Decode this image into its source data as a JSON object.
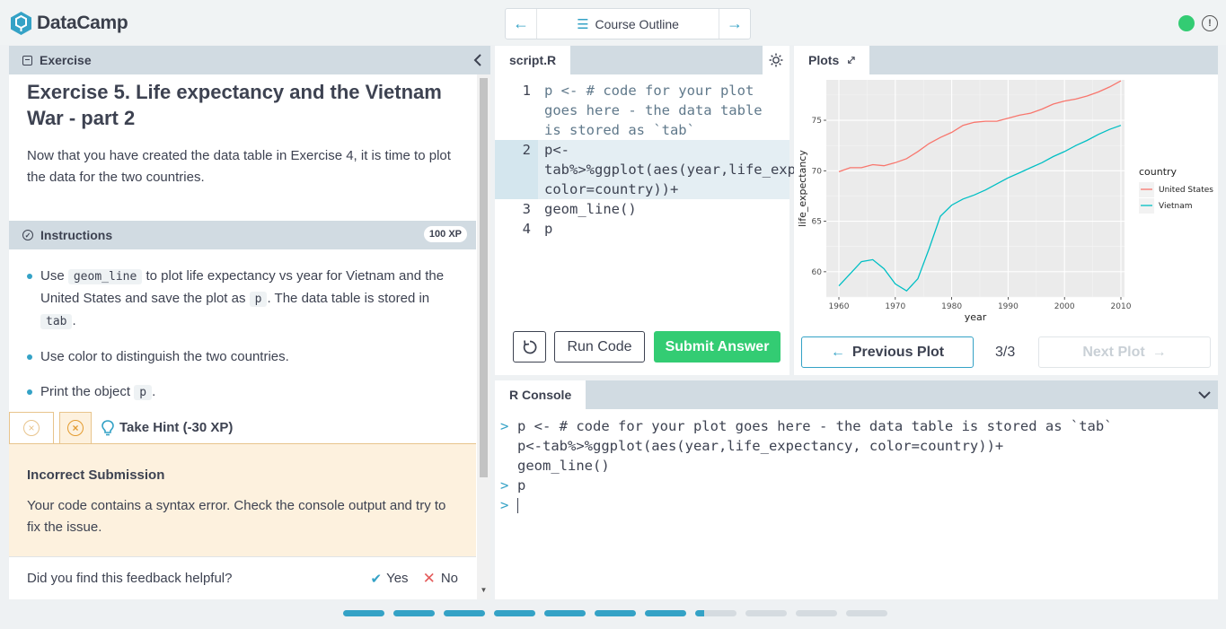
{
  "header": {
    "brand": "DataCamp",
    "nav_label": "Course Outline",
    "status_color": "#33CC73"
  },
  "exercise": {
    "panel_title": "Exercise",
    "title": "Exercise 5. Life expectancy and the Vietnam War - part 2",
    "description": "Now that you have created the data table in Exercise 4, it is time to plot the data for the two countries."
  },
  "instructions": {
    "panel_title": "Instructions",
    "xp": "100 XP",
    "items": [
      {
        "pre": "Use",
        "code": "geom_line",
        "mid": "to plot life expectancy vs year for Vietnam and the United States and save the plot as",
        "code2": "p",
        "mid2": ". The data table is stored in",
        "code3": "tab",
        "post": "."
      },
      {
        "text": "Use color to distinguish the two countries."
      },
      {
        "pre": "Print the object",
        "code": "p",
        "post": "."
      }
    ]
  },
  "hint": {
    "label": "Take Hint (-30 XP)"
  },
  "feedback": {
    "title": "Incorrect Submission",
    "text": "Your code contains a syntax error. Check the console output and try to fix the issue.",
    "question": "Did you find this feedback helpful?",
    "yes": "Yes",
    "no": "No"
  },
  "editor": {
    "tab": "script.R",
    "lines": [
      {
        "num": "1",
        "text": "p <- # code for your plot goes here - the data table is stored as `tab`"
      },
      {
        "num": "2",
        "text": "p<-tab%>%ggplot(aes(year,life_expectancy, color=country))+"
      },
      {
        "num": "3",
        "text": "geom_line()"
      },
      {
        "num": "4",
        "text": "p"
      }
    ],
    "run_label": "Run Code",
    "submit_label": "Submit Answer"
  },
  "plots": {
    "tab": "Plots",
    "prev_label": "Previous Plot",
    "counter": "3/3",
    "next_label": "Next Plot"
  },
  "chart_data": {
    "type": "line",
    "xlabel": "year",
    "ylabel": "life_expectancy",
    "x_ticks": [
      "1960",
      "1970",
      "1980",
      "1990",
      "2000",
      "2010"
    ],
    "y_ticks": [
      "60",
      "65",
      "70",
      "75"
    ],
    "xlim": [
      1960,
      2010
    ],
    "ylim": [
      57.5,
      79.0
    ],
    "legend_title": "country",
    "legend_position": "right",
    "grid": true,
    "series": [
      {
        "name": "United States",
        "color": "#F8766D",
        "x": [
          1960,
          1962,
          1964,
          1966,
          1968,
          1970,
          1972,
          1974,
          1976,
          1978,
          1980,
          1982,
          1984,
          1986,
          1988,
          1990,
          1992,
          1994,
          1996,
          1998,
          2000,
          2002,
          2004,
          2006,
          2008,
          2010
        ],
        "values": [
          69.9,
          70.3,
          70.3,
          70.6,
          70.5,
          70.8,
          71.2,
          71.9,
          72.7,
          73.3,
          73.8,
          74.5,
          74.8,
          74.9,
          74.9,
          75.2,
          75.5,
          75.7,
          76.1,
          76.6,
          76.9,
          77.1,
          77.4,
          77.8,
          78.3,
          78.9
        ]
      },
      {
        "name": "Vietnam",
        "color": "#00BFC4",
        "x": [
          1960,
          1962,
          1964,
          1966,
          1968,
          1970,
          1972,
          1974,
          1976,
          1978,
          1980,
          1982,
          1984,
          1986,
          1988,
          1990,
          1992,
          1994,
          1996,
          1998,
          2000,
          2002,
          2004,
          2006,
          2008,
          2010
        ],
        "values": [
          58.6,
          59.8,
          61.0,
          61.2,
          60.3,
          58.8,
          58.1,
          59.3,
          62.3,
          65.5,
          66.6,
          67.2,
          67.6,
          68.1,
          68.7,
          69.3,
          69.8,
          70.3,
          70.8,
          71.4,
          71.9,
          72.5,
          73.0,
          73.6,
          74.1,
          74.5
        ]
      }
    ]
  },
  "console": {
    "tab": "R Console",
    "lines": [
      {
        "prompt": ">",
        "text": "p <- # code for your plot goes here - the data table is stored as `tab`"
      },
      {
        "prompt": "",
        "text": "p<-tab%>%ggplot(aes(year,life_expectancy, color=country))+"
      },
      {
        "prompt": "",
        "text": "geom_line()"
      },
      {
        "prompt": ">",
        "text": "p"
      },
      {
        "prompt": ">",
        "text": ""
      }
    ]
  },
  "progress": {
    "completed": 7,
    "current": 8,
    "total": 11
  }
}
